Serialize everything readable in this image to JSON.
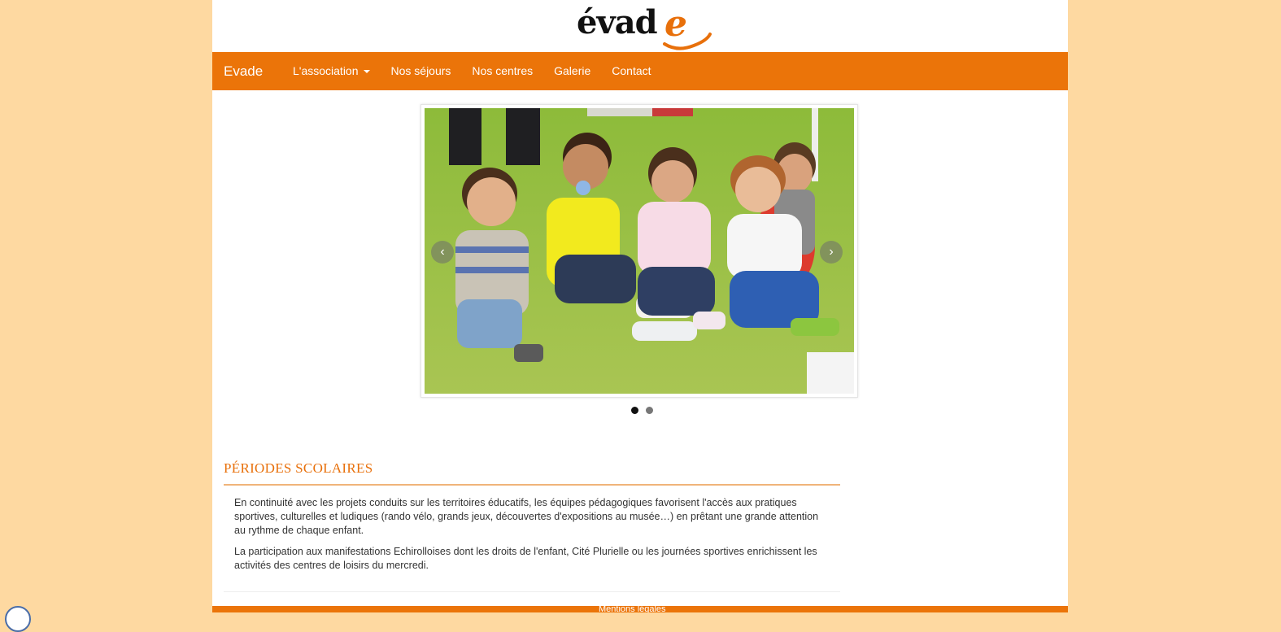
{
  "logo": {
    "text": "évad",
    "accent": "e",
    "accent_color": "#e8700b"
  },
  "navbar": {
    "background": "#eb7409",
    "brand": "Evade",
    "items": [
      {
        "label": "L'association",
        "dropdown": true
      },
      {
        "label": "Nos séjours"
      },
      {
        "label": "Nos centres"
      },
      {
        "label": "Galerie"
      },
      {
        "label": "Contact"
      }
    ]
  },
  "carousel": {
    "prev_icon": "chevron-left-icon",
    "next_icon": "chevron-right-icon",
    "prev_glyph": "‹",
    "next_glyph": "›",
    "active_index": 0,
    "slide_count": 2
  },
  "section": {
    "title": "PÉRIODES SCOLAIRES",
    "paragraphs": [
      "En continuité avec les projets conduits sur les territoires éducatifs, les équipes pédagogiques favorisent l'accès aux pratiques sportives, culturelles et ludiques (rando vélo, grands jeux, découvertes d'expositions au musée…) en prêtant une grande attention au rythme de chaque enfant.",
      "La participation aux manifestations Echirolloises dont les droits de l'enfant, Cité Plurielle ou les journées sportives enrichissent les activités des centres de loisirs du mercredi."
    ]
  },
  "footer": {
    "text": "Mentions légales"
  },
  "colors": {
    "page_background": "#fed9a1",
    "accent": "#eb7409",
    "title": "#e8700b"
  }
}
